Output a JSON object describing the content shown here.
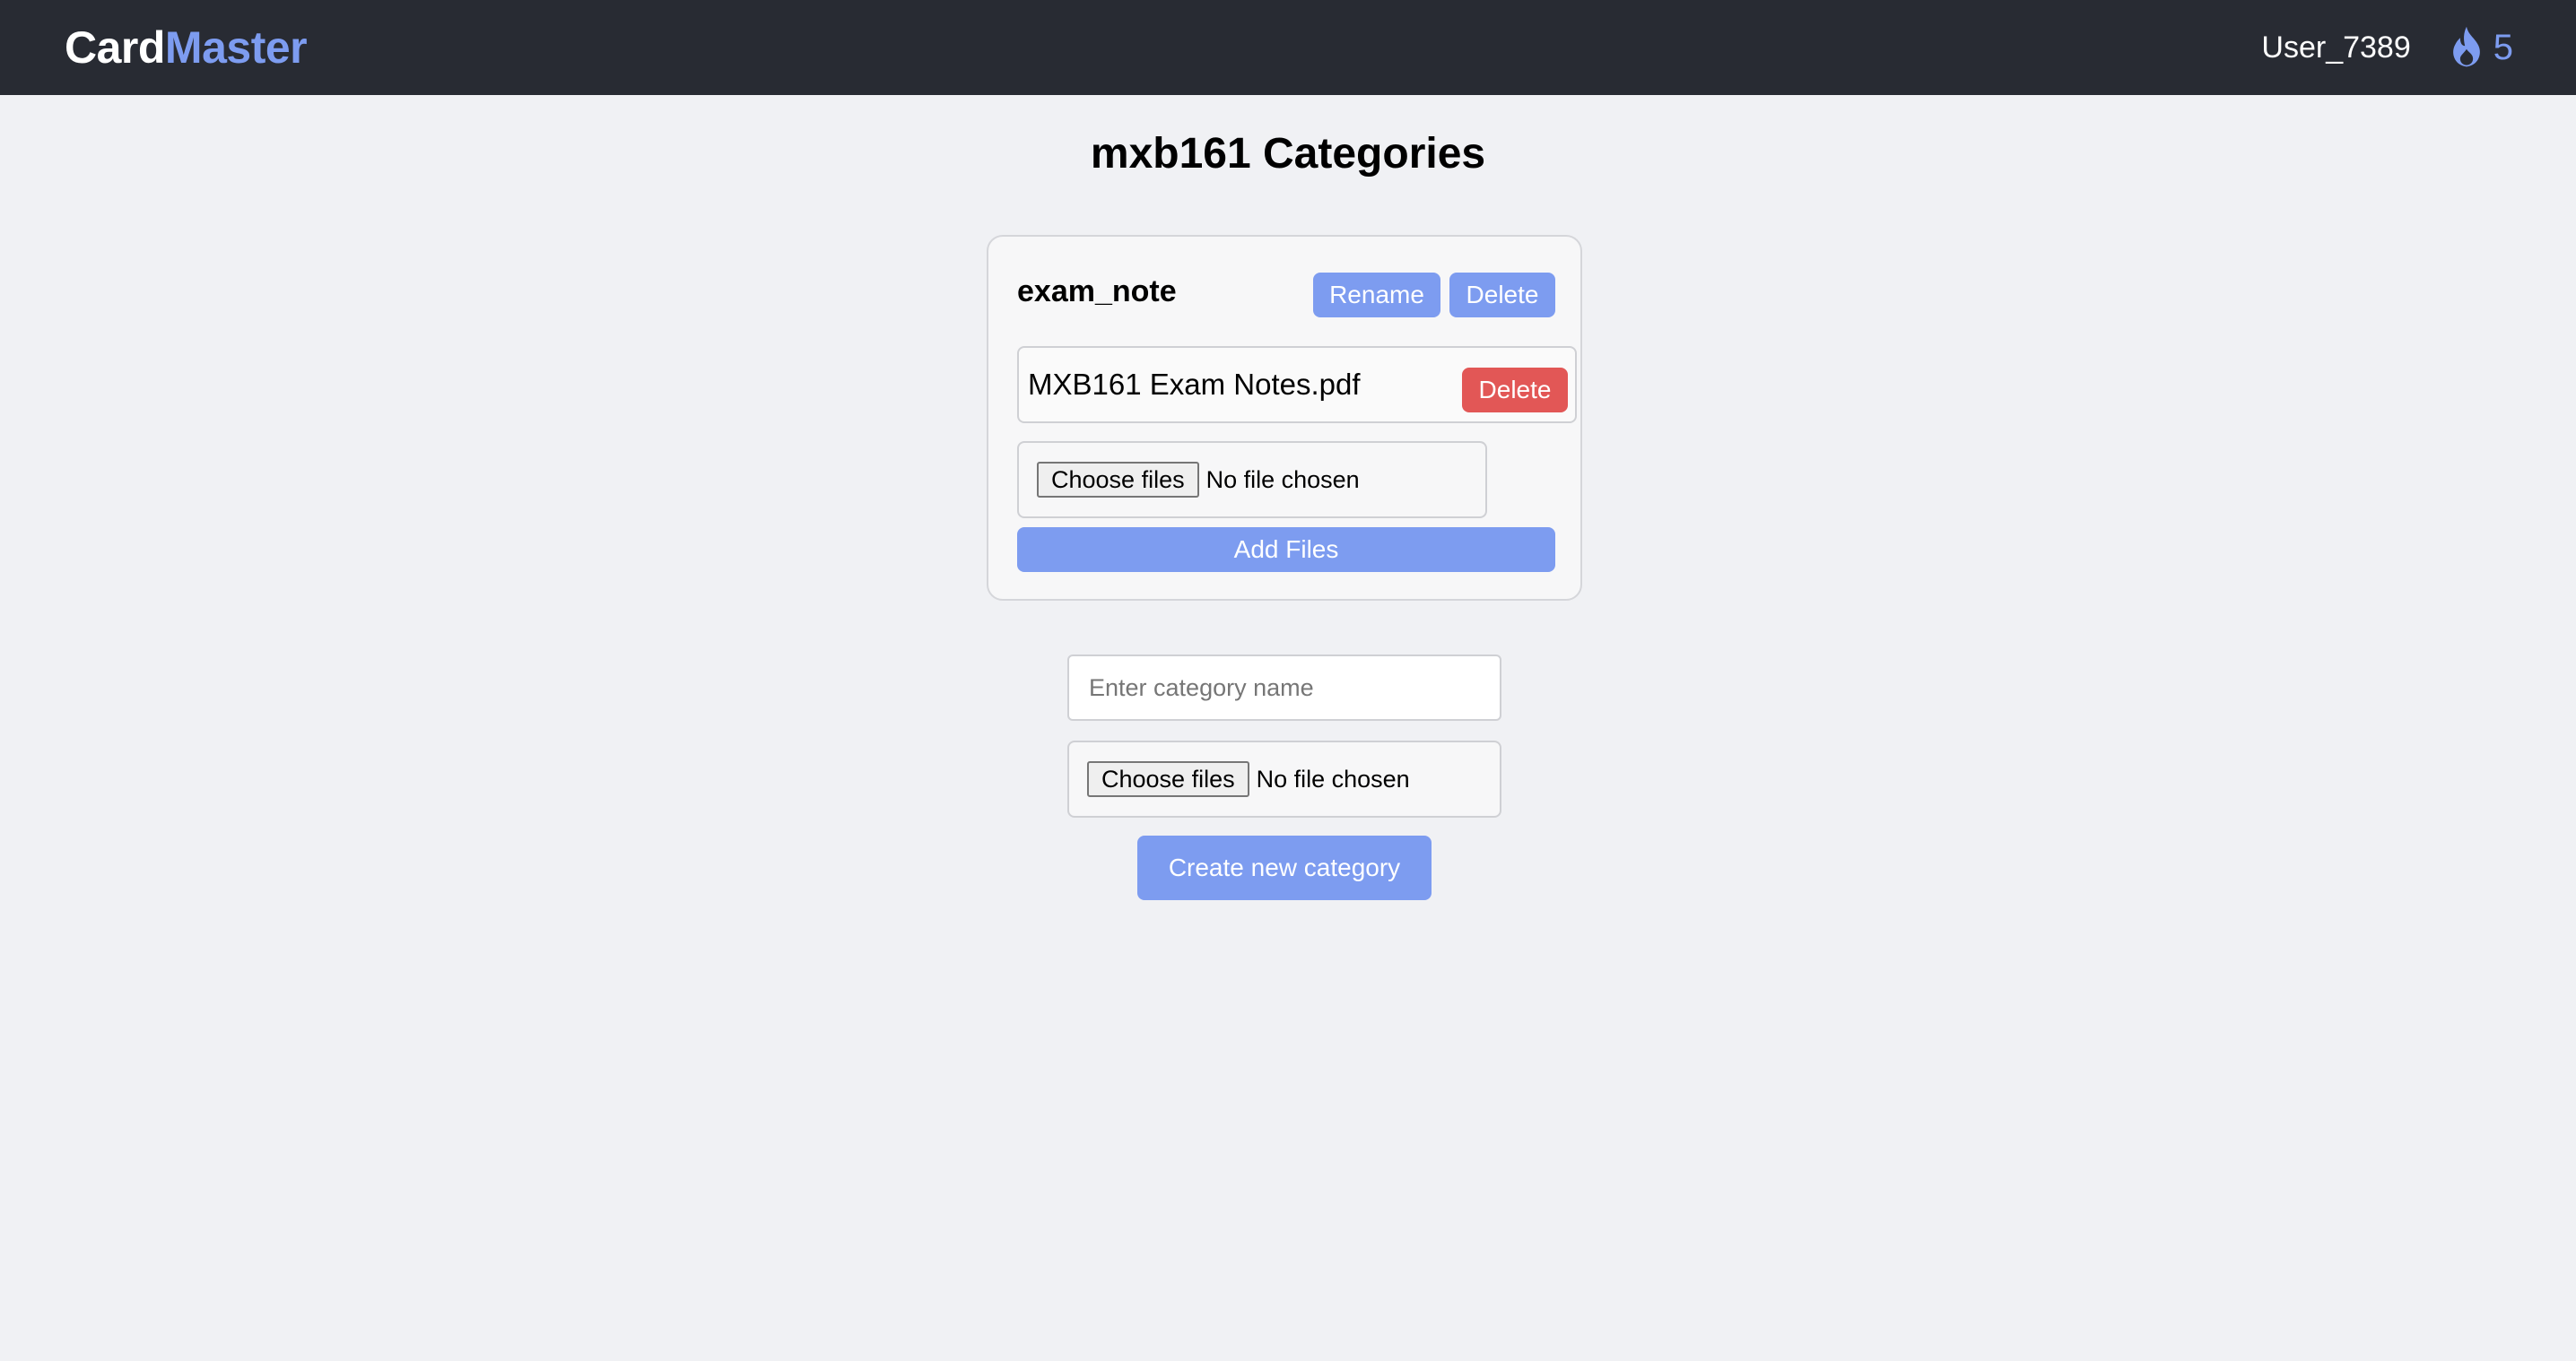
{
  "header": {
    "brand_part1": "Card",
    "brand_part2": "Master",
    "username": "User_7389",
    "streak_icon": "flame-icon",
    "streak_count": "5"
  },
  "page": {
    "title": "mxb161 Categories"
  },
  "categories": [
    {
      "name": "exam_note",
      "rename_label": "Rename",
      "delete_label": "Delete",
      "files": [
        {
          "name": "MXB161 Exam Notes.pdf",
          "delete_label": "Delete"
        }
      ],
      "file_picker": {
        "button_label": "Choose files",
        "status": "No file chosen"
      },
      "add_files_label": "Add Files"
    }
  ],
  "create_form": {
    "name_placeholder": "Enter category name",
    "name_value": "",
    "file_picker": {
      "button_label": "Choose files",
      "status": "No file chosen"
    },
    "submit_label": "Create new category"
  },
  "colors": {
    "navbar_bg": "#282b33",
    "accent": "#7d9cf0",
    "danger": "#e25756",
    "page_bg": "#f0f1f4"
  }
}
